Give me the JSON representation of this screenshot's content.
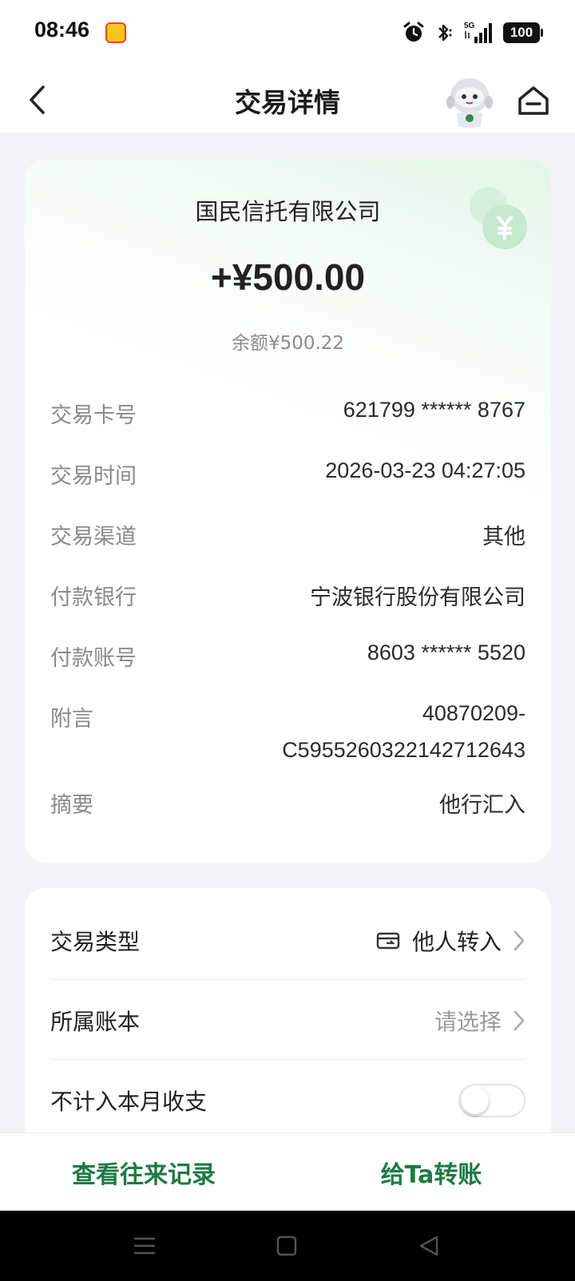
{
  "status_bar": {
    "time": "08:46",
    "network": "5G",
    "battery": "100",
    "icons": [
      "app-badge-icon",
      "alarm-icon",
      "bluetooth-icon",
      "signal-icon",
      "battery-icon"
    ]
  },
  "header": {
    "title": "交易详情",
    "icons": [
      "back-chevron-icon",
      "robot-assistant-icon",
      "home-icon"
    ]
  },
  "transaction": {
    "payee": "国民信托有限公司",
    "amount": "+¥500.00",
    "balance": "余额¥500.22",
    "details": [
      {
        "label": "交易卡号",
        "value": "621799 ****** 8767"
      },
      {
        "label": "交易时间",
        "value": "2026-03-23 04:27:05"
      },
      {
        "label": "交易渠道",
        "value": "其他"
      },
      {
        "label": "付款银行",
        "value": "宁波银行股份有限公司"
      },
      {
        "label": "付款账号",
        "value": "8603 ****** 5520"
      },
      {
        "label": "附言",
        "value_line1": "40870209-",
        "value_line2": "C5955260322142712643"
      },
      {
        "label": "摘要",
        "value": "他行汇入"
      }
    ]
  },
  "options": {
    "type_label": "交易类型",
    "type_value": "他人转入",
    "ledger_label": "所属账本",
    "ledger_placeholder": "请选择",
    "exclude_label": "不计入本月收支",
    "exclude_enabled": false
  },
  "actions": {
    "history": "查看往来记录",
    "transfer": "给Ta转账"
  },
  "colors": {
    "accent": "#1c7a45",
    "card_gradient": "#e3f6e8",
    "background": "#f4f4f6"
  }
}
